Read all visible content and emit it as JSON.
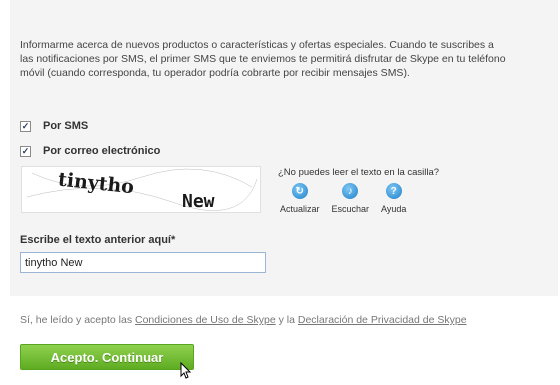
{
  "info_text": "Informarme acerca de nuevos productos o características y ofertas especiales. Cuando te suscribes a las notificaciones por SMS, el primer SMS que te enviemos te permitirá disfrutar de Skype en tu teléfono móvil (cuando corresponda, tu operador podría cobrarte por recibir mensajes SMS).",
  "options": [
    {
      "label": "Por SMS",
      "checked": true
    },
    {
      "label": "Por correo electrónico",
      "checked": true
    }
  ],
  "captcha": {
    "image_text": "tinytho New",
    "cant_read": "¿No puedes leer el texto en la casilla?",
    "tools": [
      {
        "label": "Actualizar",
        "icon": "refresh-icon"
      },
      {
        "label": "Escuchar",
        "icon": "speaker-icon"
      },
      {
        "label": "Ayuda",
        "icon": "help-icon"
      }
    ]
  },
  "field": {
    "label": "Escribe el texto anterior aquí*",
    "value": "tinytho New"
  },
  "terms": {
    "prefix": "Sí, he leído y acepto las",
    "link1": "Condiciones de Uso de Skype",
    "middle": "y la",
    "link2": "Declaración de Privacidad de Skype"
  },
  "button_label": "Acepto. Continuar",
  "colors": {
    "panel": "#f4f4f4",
    "button": "#6bbb2c",
    "icon": "#1d7fc9"
  }
}
